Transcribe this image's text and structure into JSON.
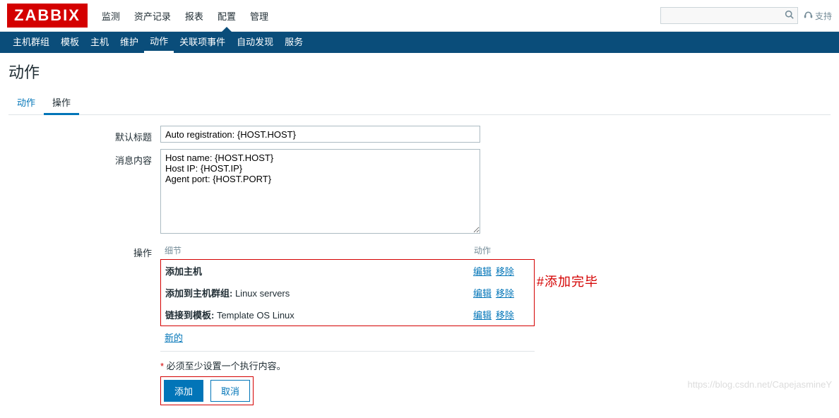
{
  "brand": "ZABBIX",
  "topnav": {
    "items": [
      "监测",
      "资产记录",
      "报表",
      "配置",
      "管理"
    ],
    "active": 3
  },
  "search": {
    "placeholder": ""
  },
  "support": {
    "label": "支持"
  },
  "subnav": {
    "items": [
      "主机群组",
      "模板",
      "主机",
      "维护",
      "动作",
      "关联项事件",
      "自动发现",
      "服务"
    ],
    "active": 4
  },
  "page_title": "动作",
  "tabs": {
    "items": [
      "动作",
      "操作"
    ],
    "active": 1
  },
  "form": {
    "subject_label": "默认标题",
    "subject_value": "Auto registration: {HOST.HOST}",
    "message_label": "消息内容",
    "message_value": "Host name: {HOST.HOST}\nHost IP: {HOST.IP}\nAgent port: {HOST.PORT}",
    "operations_label": "操作",
    "table": {
      "col_detail": "细节",
      "col_action": "动作",
      "rows": [
        {
          "label": "添加主机",
          "suffix": ""
        },
        {
          "label": "添加到主机群组:",
          "suffix": " Linux servers"
        },
        {
          "label": "链接到模板:",
          "suffix": " Template OS Linux"
        }
      ],
      "edit": "编辑",
      "remove": "移除",
      "new": "新的"
    },
    "required_note": "必须至少设置一个执行内容。",
    "add_button": "添加",
    "cancel_button": "取消"
  },
  "annotation": "#添加完毕",
  "watermark": "https://blog.csdn.net/CapejasmineY"
}
